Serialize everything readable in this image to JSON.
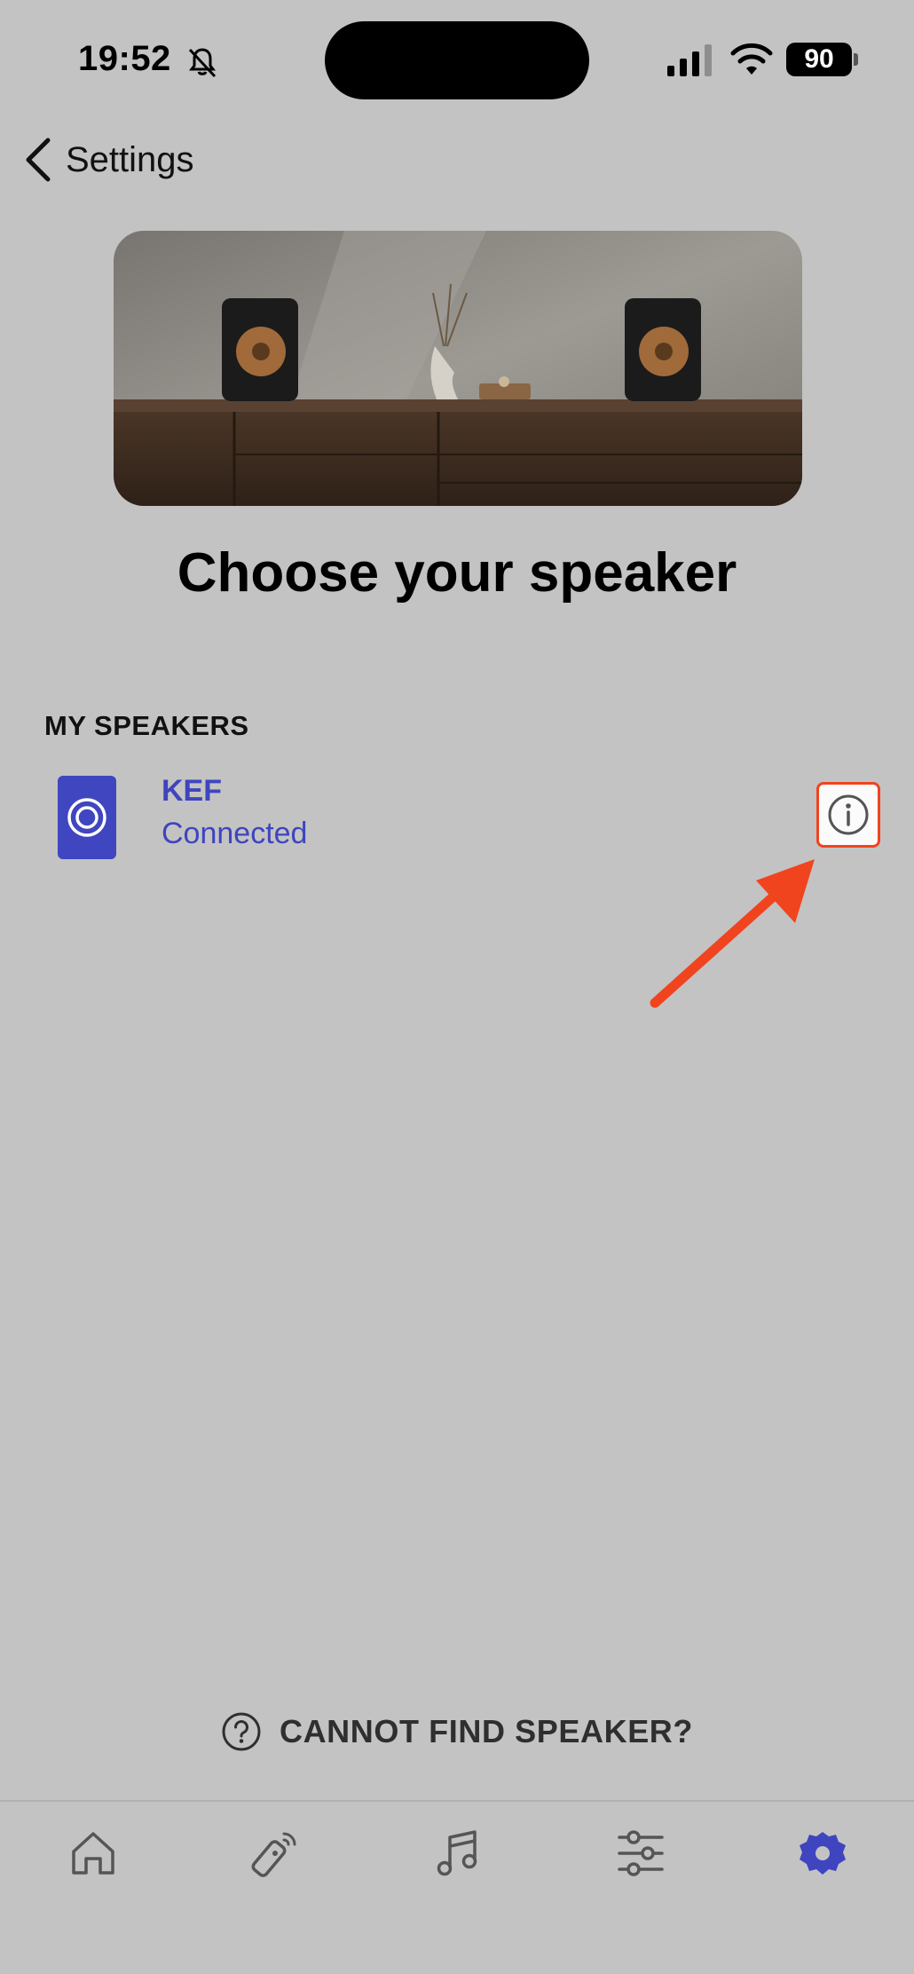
{
  "status_bar": {
    "time": "19:52",
    "battery": "90"
  },
  "nav": {
    "back_label": "Settings"
  },
  "page": {
    "title": "Choose your speaker"
  },
  "speakers_section": {
    "header": "MY SPEAKERS",
    "items": [
      {
        "name": "KEF",
        "status": "Connected"
      }
    ]
  },
  "help": {
    "label": "CANNOT FIND SPEAKER?"
  },
  "tabs": [
    {
      "icon": "home-icon"
    },
    {
      "icon": "remote-icon"
    },
    {
      "icon": "music-note-icon"
    },
    {
      "icon": "sliders-icon"
    },
    {
      "icon": "settings-gear-icon",
      "active": true
    }
  ],
  "colors": {
    "accent": "#3e45be",
    "highlight": "#f0441f",
    "background": "#c3c3c3"
  }
}
